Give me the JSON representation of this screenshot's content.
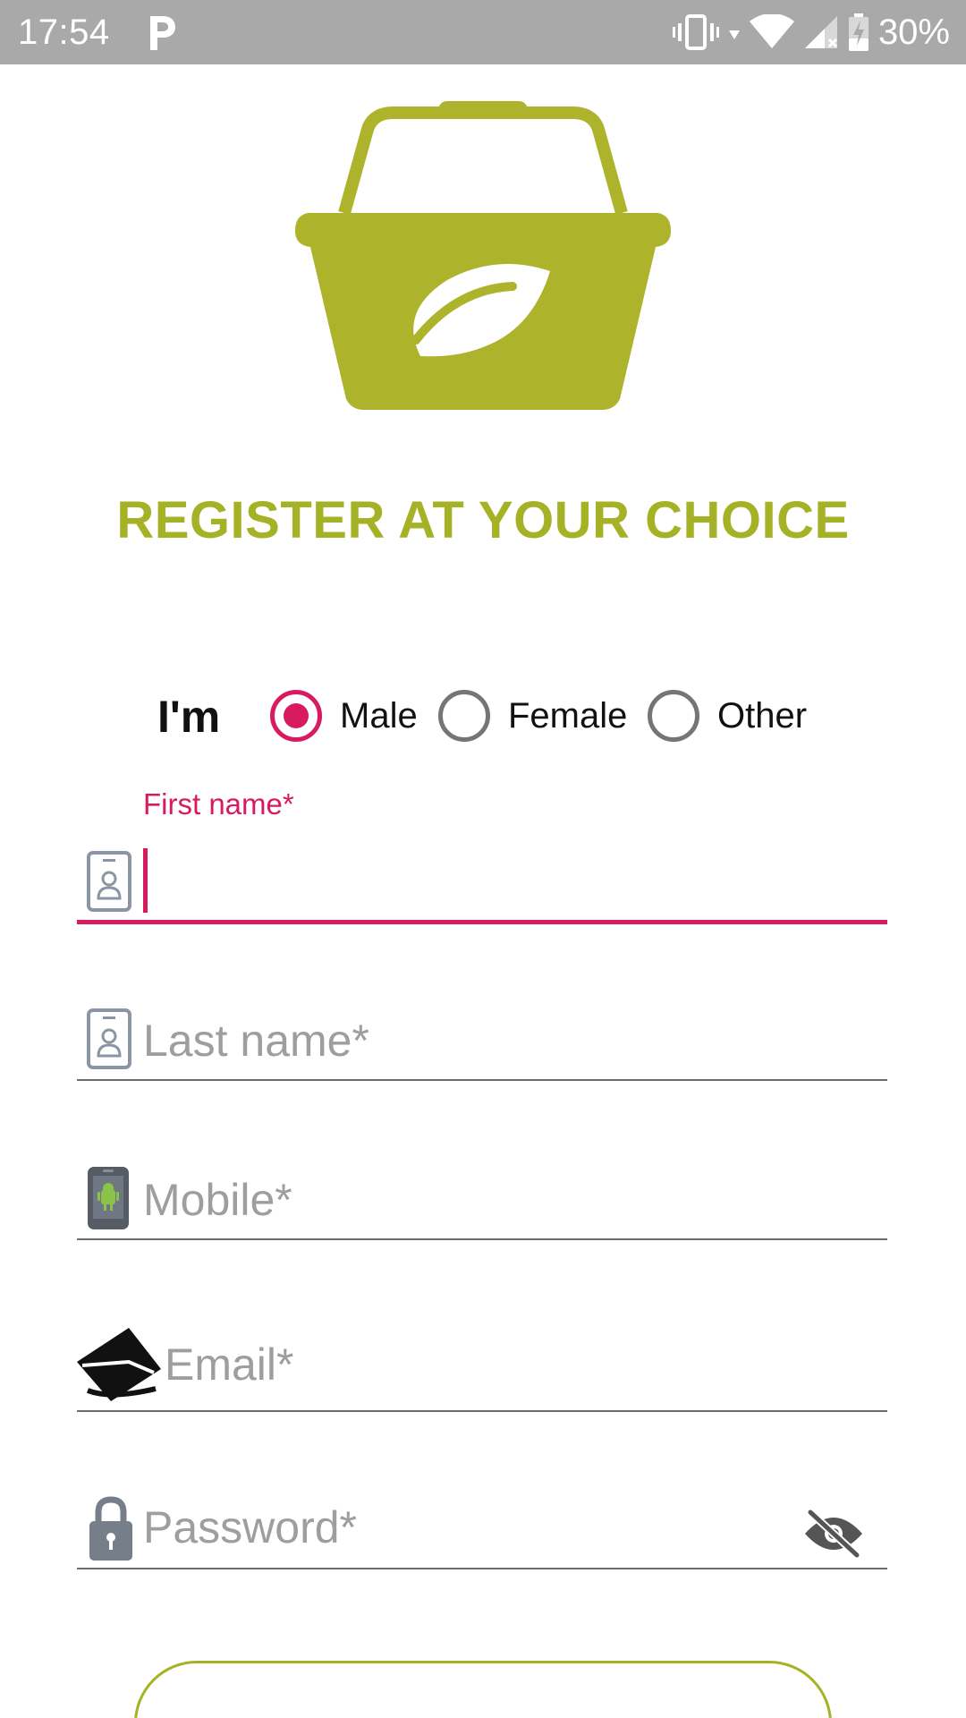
{
  "status_bar": {
    "time": "17:54",
    "battery_percent": "30%",
    "icons": [
      "parking-icon",
      "vibrate-icon",
      "wifi-icon",
      "signal-icon",
      "battery-charging-icon"
    ]
  },
  "logo": {
    "icon": "shopping-basket-leaf-logo",
    "color": "#adb32a"
  },
  "title": "REGISTER AT YOUR CHOICE",
  "gender": {
    "label": "I'm",
    "options": [
      {
        "label": "Male",
        "selected": true
      },
      {
        "label": "Female",
        "selected": false
      },
      {
        "label": "Other",
        "selected": false
      }
    ]
  },
  "form": {
    "first_name": {
      "label": "First name*",
      "value": "",
      "icon": "id-badge-icon",
      "focused": true
    },
    "last_name": {
      "placeholder": "Last name*",
      "icon": "id-badge-icon"
    },
    "mobile": {
      "placeholder": "Mobile*",
      "icon": "mobile-android-icon"
    },
    "email": {
      "placeholder": "Email*",
      "icon": "envelope-icon"
    },
    "password": {
      "placeholder": "Password*",
      "icon": "lock-icon",
      "toggle_icon": "eye-off-icon"
    }
  },
  "colors": {
    "accent": "#d81b60",
    "brand": "#a6b226",
    "status_bar": "#a9a9a9"
  }
}
